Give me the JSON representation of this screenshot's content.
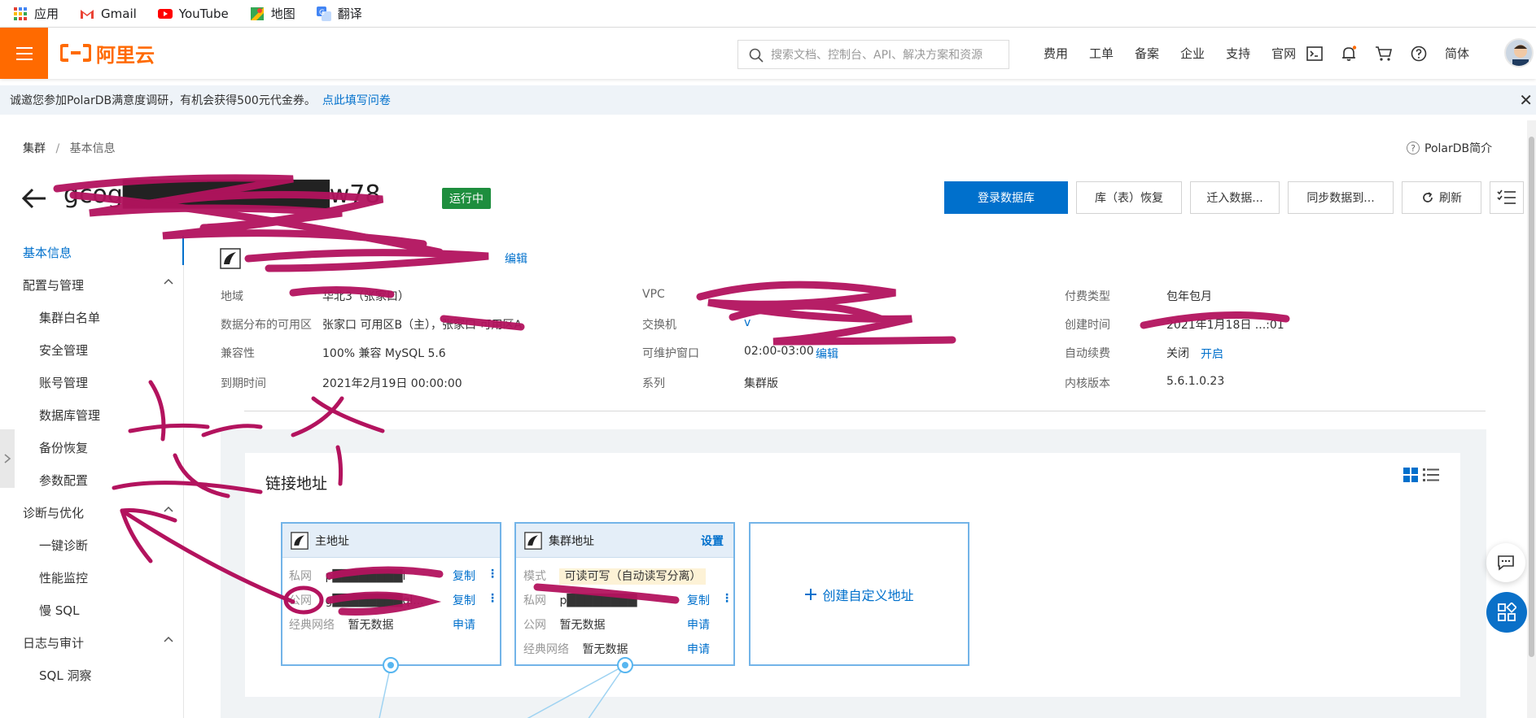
{
  "bookmarks": [
    {
      "label": "应用",
      "icon": "apps-grid-icon"
    },
    {
      "label": "Gmail",
      "icon": "gmail-icon"
    },
    {
      "label": "YouTube",
      "icon": "youtube-icon"
    },
    {
      "label": "地图",
      "icon": "maps-icon"
    },
    {
      "label": "翻译",
      "icon": "translate-icon"
    }
  ],
  "topnav": {
    "logo_text": "阿里云",
    "search_placeholder": "搜索文档、控制台、API、解决方案和资源",
    "links": [
      "费用",
      "工单",
      "备案",
      "企业",
      "支持",
      "官网"
    ],
    "lang": "简体"
  },
  "notice": {
    "text": "诚邀您参加PolarDB满意度调研，有机会获得500元代金券。",
    "link": "点此填写问卷",
    "close": "✕"
  },
  "breadcrumb": {
    "root": "集群",
    "sep": "/",
    "current": "基本信息"
  },
  "intro": {
    "label": "PolarDB简介",
    "q": "?"
  },
  "header": {
    "title": "gcog███████████w78",
    "status": "运行中"
  },
  "actions": {
    "login": "登录数据库",
    "restore": "库（表）恢复",
    "migrate": "迁入数据...",
    "sync": "同步数据到...",
    "refresh": "刷新"
  },
  "sidebar": {
    "basic": "基本信息",
    "config_group": "配置与管理",
    "config_items": [
      "集群白名单",
      "安全管理",
      "账号管理",
      "数据库管理",
      "备份恢复",
      "参数配置"
    ],
    "diag_group": "诊断与优化",
    "diag_items": [
      "一键诊断",
      "性能监控",
      "慢 SQL"
    ],
    "log_group": "日志与审计",
    "log_items": [
      "SQL 洞察"
    ]
  },
  "cluster_name_row": {
    "edit": "编辑"
  },
  "info": {
    "col1": [
      {
        "label": "地域",
        "value": "华北3（张家口）"
      },
      {
        "label": "数据分布的可用区",
        "value": "张家口 可用区B（主），张家口 可用区A"
      },
      {
        "label": "兼容性",
        "value": "100% 兼容 MySQL 5.6"
      },
      {
        "label": "到期时间",
        "value": "2021年2月19日 00:00:00"
      }
    ],
    "col2": [
      {
        "label": "VPC",
        "value": ""
      },
      {
        "label": "交换机",
        "value": "v"
      },
      {
        "label": "可维护窗口",
        "value": "02:00-03:00",
        "link": "编辑"
      },
      {
        "label": "系列",
        "value": "集群版"
      }
    ],
    "col3": [
      {
        "label": "付费类型",
        "value": "包年包月"
      },
      {
        "label": "创建时间",
        "value": "2021年1月18日 ...:01"
      },
      {
        "label": "自动续费",
        "value": "关闭",
        "link": "开启"
      },
      {
        "label": "内核版本",
        "value": "5.6.1.0.23"
      }
    ]
  },
  "connection": {
    "title": "链接地址",
    "primary_card": {
      "title": "主地址",
      "rows": [
        {
          "k": "私网",
          "v": "p████████l",
          "action": "复制"
        },
        {
          "k": "公网",
          "v": "g████████ql...",
          "action": "复制"
        },
        {
          "k": "经典网络",
          "v": "暂无数据",
          "action": "申请"
        }
      ]
    },
    "cluster_card": {
      "title": "集群地址",
      "setting": "设置",
      "mode_label": "模式",
      "mode_value": "可读可写（自动读写分离）",
      "rows": [
        {
          "k": "私网",
          "v": "p████████",
          "action": "复制"
        },
        {
          "k": "公网",
          "v": "暂无数据",
          "action": "申请"
        },
        {
          "k": "经典网络",
          "v": "暂无数据",
          "action": "申请"
        }
      ]
    },
    "create_label": "创建自定义地址"
  },
  "annotation": {
    "text": "这个",
    "note": "handwritten red annotation with arrow pointing to 公网"
  }
}
